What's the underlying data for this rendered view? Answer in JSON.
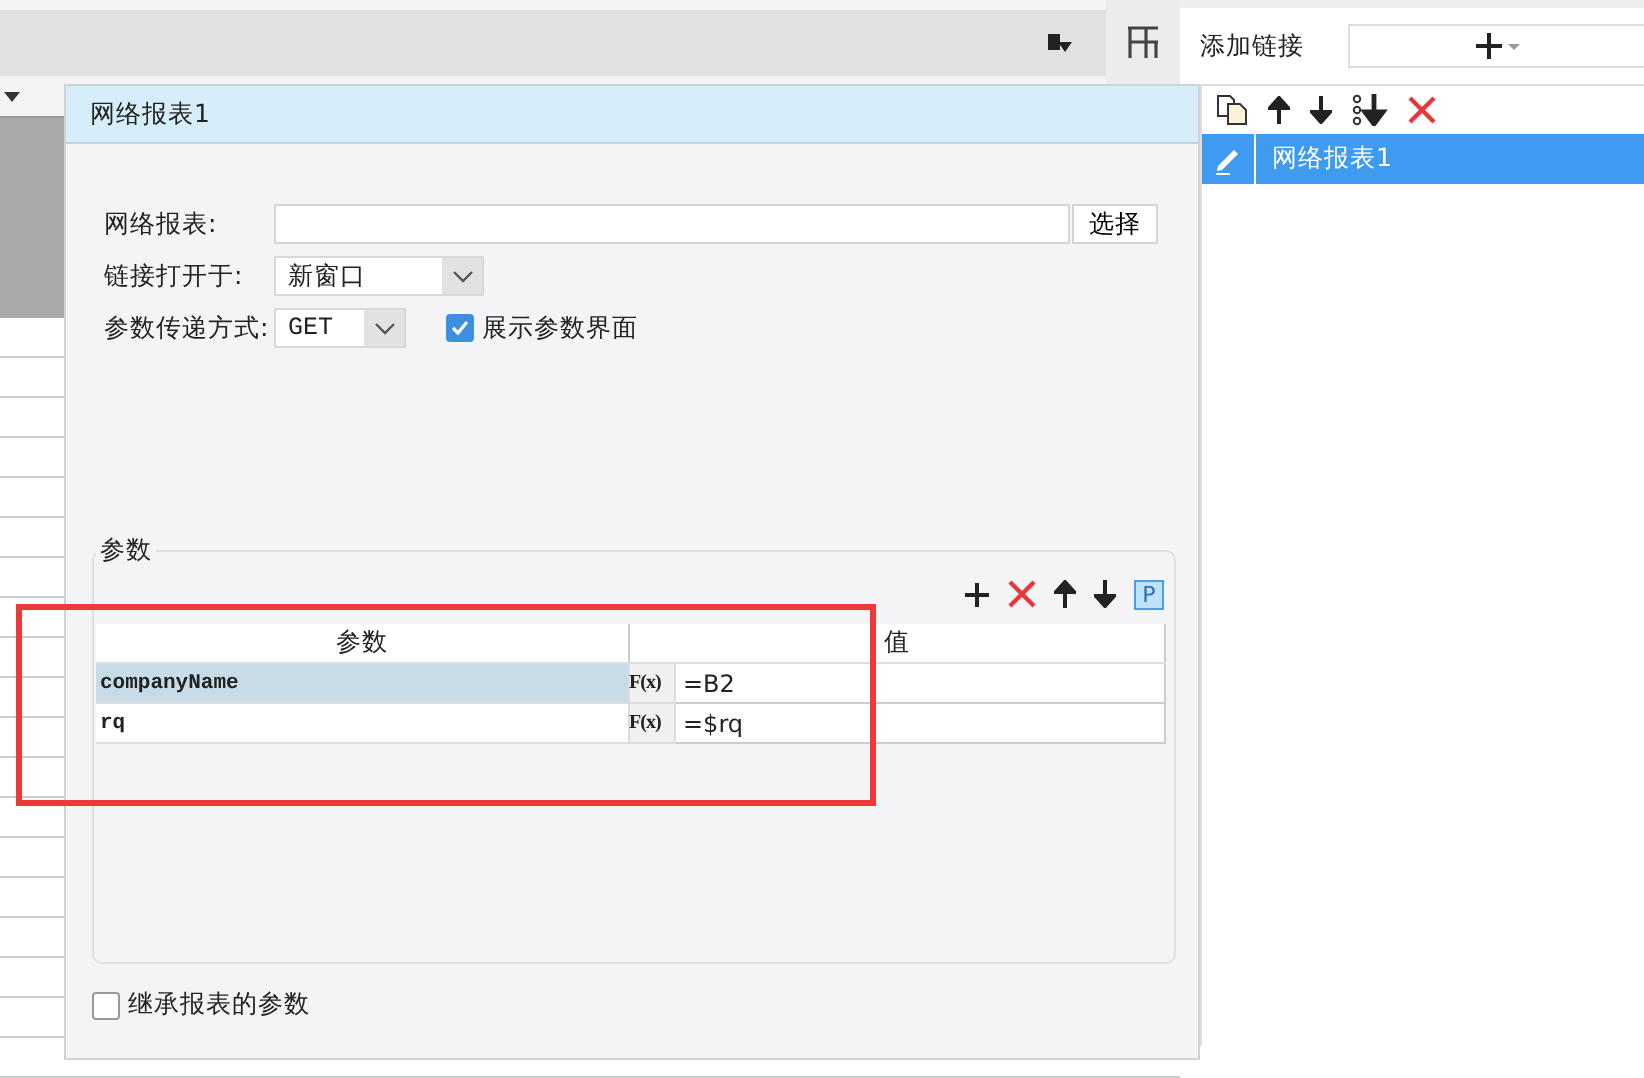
{
  "dialog": {
    "title": "网络报表1",
    "report_label": "网络报表:",
    "choose_button": "选择",
    "open_label": "链接打开于:",
    "open_value": "新窗口",
    "method_label": "参数传递方式:",
    "method_value": "GET",
    "show_params": {
      "label": "展示参数界面",
      "checked": true
    },
    "params": {
      "title": "参数",
      "p_button": "P",
      "columns": [
        "参数",
        "值"
      ],
      "rows": [
        {
          "name": "companyName",
          "formula": "F(x)",
          "value": "=B2",
          "selected": true
        },
        {
          "name": "rq",
          "formula": "F(x)",
          "value": "=$rq",
          "selected": false
        }
      ]
    },
    "inherit": {
      "label": "继承报表的参数",
      "checked": false
    }
  },
  "link_panel": {
    "add_label": "添加链接",
    "items": [
      {
        "label": "网络报表1",
        "selected": true
      }
    ]
  }
}
